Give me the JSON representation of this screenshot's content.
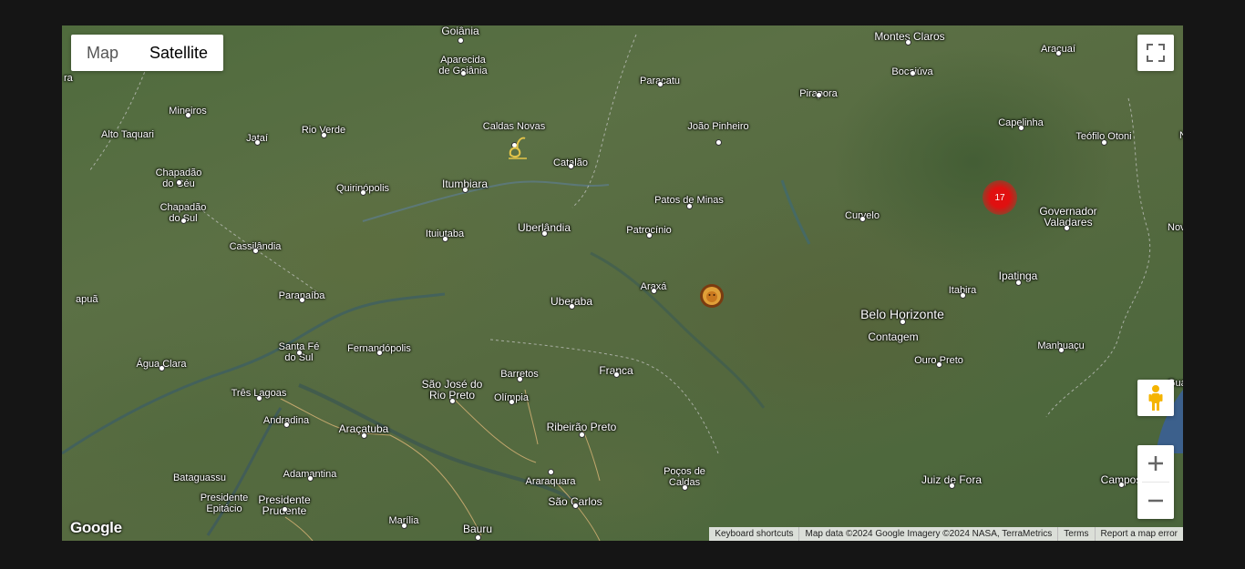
{
  "map_type": {
    "options": [
      "Map",
      "Satellite"
    ],
    "selected": "Satellite"
  },
  "cluster": {
    "count": "17",
    "color": "#e01010"
  },
  "places": [
    {
      "name": "Goiânia",
      "size": "big"
    },
    {
      "name": "Aparecida\nde Goiânia",
      "size": "normal"
    },
    {
      "name": "Montes Claros",
      "size": "big"
    },
    {
      "name": "Araçuaí",
      "size": "normal"
    },
    {
      "name": "Paracatu",
      "size": "normal"
    },
    {
      "name": "Pirapora",
      "size": "normal"
    },
    {
      "name": "Bocaiúva",
      "size": "normal"
    },
    {
      "name": "Mineiros",
      "size": "normal"
    },
    {
      "name": "Alto Taquari",
      "size": "normal"
    },
    {
      "name": "Jataí",
      "size": "normal"
    },
    {
      "name": "Rio Verde",
      "size": "normal"
    },
    {
      "name": "Caldas Novas",
      "size": "normal"
    },
    {
      "name": "João Pinheiro",
      "size": "normal"
    },
    {
      "name": "Capelinha",
      "size": "normal"
    },
    {
      "name": "Teófilo Otoni",
      "size": "normal"
    },
    {
      "name": "Chapadão\ndo Céu",
      "size": "normal"
    },
    {
      "name": "Catalão",
      "size": "normal"
    },
    {
      "name": "Quirinópolis",
      "size": "normal"
    },
    {
      "name": "Itumbiara",
      "size": "big"
    },
    {
      "name": "Chapadão\ndo Sul",
      "size": "normal"
    },
    {
      "name": "Patos de Minas",
      "size": "normal"
    },
    {
      "name": "Curvelo",
      "size": "normal"
    },
    {
      "name": "Governador\nValadares",
      "size": "big"
    },
    {
      "name": "Uberlândia",
      "size": "big"
    },
    {
      "name": "Ituiutaba",
      "size": "normal"
    },
    {
      "name": "Patrocínio",
      "size": "normal"
    },
    {
      "name": "Cassilândia",
      "size": "normal"
    },
    {
      "name": "Ipatinga",
      "size": "big"
    },
    {
      "name": "Araxá",
      "size": "normal"
    },
    {
      "name": "Itabira",
      "size": "normal"
    },
    {
      "name": "Paranaíba",
      "size": "normal"
    },
    {
      "name": "Uberaba",
      "size": "big"
    },
    {
      "name": "Belo Horizonte",
      "size": "huge"
    },
    {
      "name": "Contagem",
      "size": "big"
    },
    {
      "name": "Santa Fé\ndo Sul",
      "size": "normal"
    },
    {
      "name": "Fernandópolis",
      "size": "normal"
    },
    {
      "name": "Manhuaçu",
      "size": "normal"
    },
    {
      "name": "Água Clara",
      "size": "normal"
    },
    {
      "name": "Ouro Preto",
      "size": "normal"
    },
    {
      "name": "Franca",
      "size": "big"
    },
    {
      "name": "Barretos",
      "size": "normal"
    },
    {
      "name": "São José do\nRio Preto",
      "size": "big"
    },
    {
      "name": "Três Lagoas",
      "size": "normal"
    },
    {
      "name": "Olímpia",
      "size": "normal"
    },
    {
      "name": "Andradina",
      "size": "normal"
    },
    {
      "name": "Araçatuba",
      "size": "big"
    },
    {
      "name": "Ribeirão Preto",
      "size": "big"
    },
    {
      "name": "Poços de\nCaldas",
      "size": "normal"
    },
    {
      "name": "Bataguassu",
      "size": "normal"
    },
    {
      "name": "Adamantina",
      "size": "normal"
    },
    {
      "name": "Juiz de Fora",
      "size": "big"
    },
    {
      "name": "Campos",
      "size": "big"
    },
    {
      "name": "Araraquara",
      "size": "normal"
    },
    {
      "name": "Presidente\nEpitácio",
      "size": "normal"
    },
    {
      "name": "Presidente\nPrudente",
      "size": "big"
    },
    {
      "name": "São Carlos",
      "size": "big"
    },
    {
      "name": "Marília",
      "size": "normal"
    },
    {
      "name": "Bauru",
      "size": "big"
    },
    {
      "name": "apuã",
      "size": "normal"
    },
    {
      "name": "ra",
      "size": "normal"
    },
    {
      "name": "Nov",
      "size": "normal"
    },
    {
      "name": "N",
      "size": "normal"
    },
    {
      "name": "Gua",
      "size": "normal"
    }
  ],
  "attribution": {
    "keyboard": "Keyboard shortcuts",
    "data": "Map data ©2024 Google Imagery ©2024 NASA, TerraMetrics",
    "terms": "Terms",
    "report": "Report a map error"
  },
  "logo": "Google",
  "icons": {
    "fullscreen": "fullscreen-icon",
    "pegman": "pegman-icon",
    "zoom_in": "plus-icon",
    "zoom_out": "minus-icon",
    "marker_1": "swan-logo-marker",
    "marker_2": "lion-logo-marker"
  }
}
